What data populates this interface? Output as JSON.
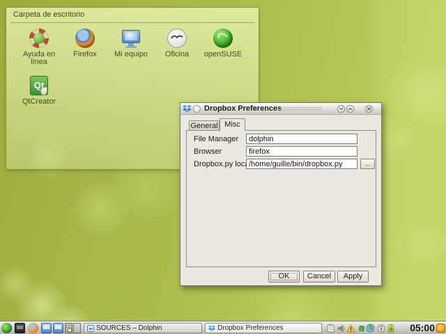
{
  "folder_view": {
    "title": "Carpeta de escritorio",
    "icons": [
      {
        "label": "Ayuda en línea"
      },
      {
        "label": "Firefox"
      },
      {
        "label": "Mi equipo"
      },
      {
        "label": "Oficina"
      },
      {
        "label": "openSUSE"
      },
      {
        "label": "QtCreator"
      }
    ]
  },
  "dialog": {
    "title": "Dropbox Preferences",
    "tabs": [
      {
        "label": "General"
      },
      {
        "label": "Misc"
      }
    ],
    "fields": [
      {
        "label": "File Manager",
        "value": "dolphin"
      },
      {
        "label": "Browser",
        "value": "firefox"
      },
      {
        "label": "Dropbox.py location",
        "value": "/home/guille/bin/dropbox.py"
      }
    ],
    "browse_button": "...",
    "buttons": [
      {
        "label": "OK"
      },
      {
        "label": "Cancel"
      },
      {
        "label": "Apply"
      }
    ]
  },
  "taskbar": {
    "tasks": [
      {
        "label": "SOURCES – Dolphin"
      },
      {
        "label": "Dropbox Preferences"
      }
    ],
    "clock": "05:00"
  },
  "colors": {
    "wallpaper_green": "#aaba4a",
    "dialog_bg": "#ebe7e1",
    "dropbox_blue": "#3d9ae8",
    "suse_green": "#3aa428",
    "warning_yellow": "#f0c020"
  }
}
